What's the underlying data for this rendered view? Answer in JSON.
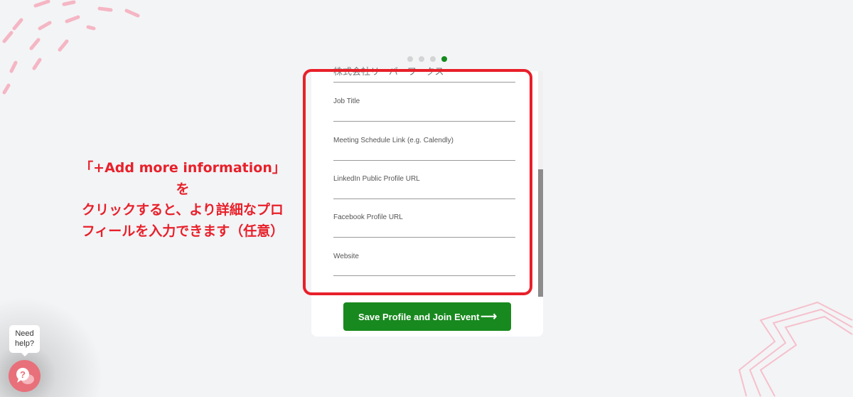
{
  "stepper": {
    "total": 4,
    "active": 4
  },
  "form": {
    "company_value": "株式会社リーバーワークス",
    "fields": [
      {
        "label": "Job Title",
        "value": ""
      },
      {
        "label": "Meeting Schedule Link (e.g. Calendly)",
        "value": ""
      },
      {
        "label": "LinkedIn Public Profile URL",
        "value": ""
      },
      {
        "label": "Facebook Profile URL",
        "value": ""
      },
      {
        "label": "Website",
        "value": ""
      }
    ],
    "submit_label": "Save Profile and Join Event",
    "submit_arrow": "⟶"
  },
  "annotation": {
    "lines": [
      "「+Add more information」を",
      "クリックすると、より詳細なプロ",
      "フィールを入力できます（任意）"
    ],
    "color": "#e8202a"
  },
  "help": {
    "bubble_line1": "Need",
    "bubble_line2": "help?",
    "icon": "question-chat-icon"
  },
  "colors": {
    "accent": "#18891e",
    "annotation": "#e8202a",
    "help": "#e8707a"
  }
}
